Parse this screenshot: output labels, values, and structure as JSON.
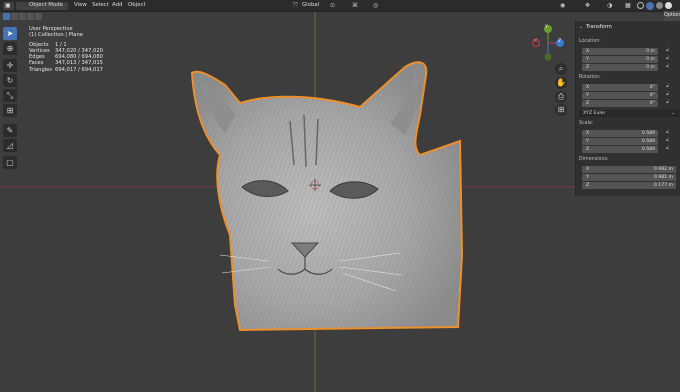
{
  "header": {
    "mode": "Object Mode",
    "menus": [
      "View",
      "Select",
      "Add",
      "Object"
    ],
    "transform_orientation": "Global"
  },
  "side_tab": "Options",
  "viewport": {
    "view_name": "User Perspective",
    "collection": "(1) Collection | Plane",
    "stats": [
      {
        "label": "Objects",
        "value": "1 / 1"
      },
      {
        "label": "Vertices",
        "value": "347,020 / 347,020"
      },
      {
        "label": "Edges",
        "value": "694,080 / 694,080"
      },
      {
        "label": "Faces",
        "value": "347,013 / 347,015"
      },
      {
        "label": "Triangles",
        "value": "694,017 / 694,017"
      }
    ]
  },
  "gizmo": {
    "x": "X",
    "y": "Y",
    "z": "Z"
  },
  "npanel": {
    "title": "Transform",
    "location_label": "Location:",
    "location": [
      {
        "axis": "X",
        "value": "0 m"
      },
      {
        "axis": "Y",
        "value": "0 m"
      },
      {
        "axis": "Z",
        "value": "0 m"
      }
    ],
    "rotation_label": "Rotation:",
    "rotation": [
      {
        "axis": "X",
        "value": "0°"
      },
      {
        "axis": "Y",
        "value": "0°"
      },
      {
        "axis": "Z",
        "value": "0°"
      }
    ],
    "rotation_mode": "XYZ Euler",
    "scale_label": "Scale:",
    "scale": [
      {
        "axis": "X",
        "value": "0.589"
      },
      {
        "axis": "Y",
        "value": "0.589"
      },
      {
        "axis": "Z",
        "value": "0.589"
      }
    ],
    "dimensions_label": "Dimensions:",
    "dimensions": [
      {
        "axis": "X",
        "value": "0.982 m"
      },
      {
        "axis": "Y",
        "value": "0.981 m"
      },
      {
        "axis": "Z",
        "value": "0.177 m"
      }
    ]
  },
  "colors": {
    "selection_outline": "#f0902a",
    "active_tool": "#4772b3",
    "x_axis": "#c93b4a",
    "y_axis": "#6aa12a",
    "z_axis": "#3b78d6"
  }
}
